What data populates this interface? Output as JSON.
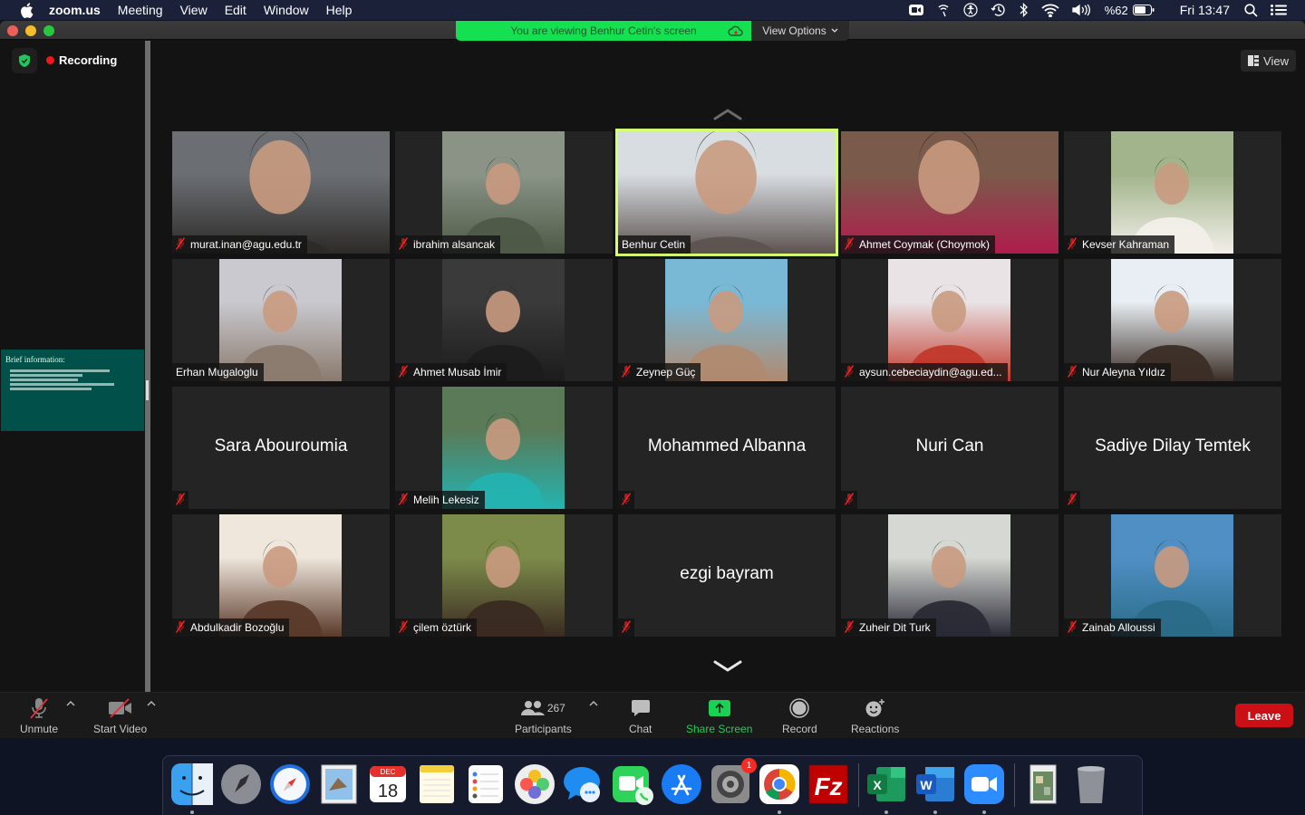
{
  "menubar": {
    "app_name": "zoom.us",
    "menus": [
      "Meeting",
      "View",
      "Edit",
      "Window",
      "Help"
    ],
    "battery_text": "%62",
    "clock": "Fri 13:47",
    "status_icons": [
      "zoom-icon",
      "airdrop-icon",
      "accessibility-icon",
      "time-machine-icon",
      "bluetooth-icon",
      "wifi-icon",
      "volume-icon",
      "battery-icon",
      "spotlight-icon",
      "control-center-icon"
    ]
  },
  "window": {
    "share_banner": "You are viewing Benhur Cetin's screen",
    "view_options_label": "View Options",
    "recording_label": "Recording",
    "view_button_label": "View",
    "shared_slide": {
      "title": "Brief information:",
      "line_count": 5
    }
  },
  "colors": {
    "share_green": "#14e052",
    "active_speaker": "#d4ff6e",
    "leave_red": "#cc0f14",
    "slide_teal": "#015049"
  },
  "participants": [
    {
      "name": "murat.inan@agu.edu.tr",
      "muted": true,
      "video": "full",
      "tone": [
        "#6b6f74",
        "#2d2a27"
      ]
    },
    {
      "name": "ibrahim alsancak",
      "muted": true,
      "video": "square",
      "tone": [
        "#8a9386",
        "#4e5a47"
      ]
    },
    {
      "name": "Benhur Cetin",
      "muted": false,
      "video": "full",
      "active": true,
      "tone": [
        "#d8dde2",
        "#5d5350"
      ]
    },
    {
      "name": "Ahmet Coymak (Choymok)",
      "muted": true,
      "video": "full",
      "tone": [
        "#7a5a4a",
        "#b01c4d"
      ]
    },
    {
      "name": "Kevser Kahraman",
      "muted": true,
      "video": "square",
      "tone": [
        "#a2b48c",
        "#f2efe9"
      ]
    },
    {
      "name": "Erhan Mugaloglu",
      "muted": false,
      "video": "square",
      "tone": [
        "#c9c9cf",
        "#8b7a6e"
      ]
    },
    {
      "name": "Ahmet Musab İmir",
      "muted": true,
      "video": "square",
      "tone": [
        "#3a3a3a",
        "#1c1c1c"
      ]
    },
    {
      "name": "Zeynep Güç",
      "muted": true,
      "video": "square",
      "tone": [
        "#79b9d6",
        "#b08a70"
      ]
    },
    {
      "name": "aysun.cebeciaydin@agu.ed...",
      "muted": true,
      "video": "square",
      "tone": [
        "#e9e3e6",
        "#c0392b"
      ]
    },
    {
      "name": "Nur Aleyna Yıldız",
      "muted": true,
      "video": "square",
      "tone": [
        "#e8eef3",
        "#3a2d26"
      ]
    },
    {
      "name": "Sara Abouroumia",
      "muted": true,
      "video": "none"
    },
    {
      "name": "Melih Lekesiz",
      "muted": true,
      "video": "square",
      "tone": [
        "#5a7a58",
        "#24b3b0"
      ]
    },
    {
      "name": "Mohammed Albanna",
      "muted": true,
      "video": "none"
    },
    {
      "name": "Nuri Can",
      "muted": true,
      "video": "none"
    },
    {
      "name": "Sadiye Dilay Temtek",
      "muted": true,
      "video": "none"
    },
    {
      "name": "Abdulkadir Bozoğlu",
      "muted": true,
      "video": "square",
      "tone": [
        "#efe6dc",
        "#5a3a2a"
      ]
    },
    {
      "name": "çilem öztürk",
      "muted": true,
      "video": "square",
      "tone": [
        "#7d8b4a",
        "#3a2a22"
      ]
    },
    {
      "name": "ezgi bayram",
      "muted": true,
      "video": "none"
    },
    {
      "name": "Zuheir Dit Turk",
      "muted": true,
      "video": "square",
      "tone": [
        "#d6d8d4",
        "#2a2a36"
      ]
    },
    {
      "name": "Zainab Alloussi",
      "muted": true,
      "video": "square",
      "tone": [
        "#4f8fc4",
        "#2a6c88"
      ]
    }
  ],
  "toolbar": {
    "unmute": "Unmute",
    "start_video": "Start Video",
    "participants": "Participants",
    "participant_count": "267",
    "chat": "Chat",
    "share_screen": "Share Screen",
    "record": "Record",
    "reactions": "Reactions",
    "leave": "Leave"
  },
  "dock": {
    "apps": [
      {
        "name": "Finder",
        "icon": "finder-icon",
        "running": true
      },
      {
        "name": "Launchpad",
        "icon": "launchpad-icon",
        "running": false
      },
      {
        "name": "Safari",
        "icon": "safari-icon",
        "running": false
      },
      {
        "name": "Mail",
        "icon": "mail-icon",
        "running": false
      },
      {
        "name": "Calendar",
        "icon": "calendar-icon",
        "running": false,
        "month": "DEC",
        "day": "18"
      },
      {
        "name": "Notes",
        "icon": "notes-icon",
        "running": false
      },
      {
        "name": "Reminders",
        "icon": "reminders-icon",
        "running": false
      },
      {
        "name": "Photos",
        "icon": "photos-icon",
        "running": false
      },
      {
        "name": "Messages",
        "icon": "messages-icon",
        "running": false
      },
      {
        "name": "FaceTime",
        "icon": "facetime-icon",
        "running": false
      },
      {
        "name": "App Store",
        "icon": "app-store-icon",
        "running": false
      },
      {
        "name": "System Preferences",
        "icon": "system-preferences-icon",
        "running": false,
        "badge": "1"
      },
      {
        "name": "Chrome",
        "icon": "chrome-icon",
        "running": true
      },
      {
        "name": "FileZilla",
        "icon": "filezilla-icon",
        "running": false
      },
      {
        "name": "Excel",
        "icon": "excel-icon",
        "running": true
      },
      {
        "name": "Word",
        "icon": "word-icon",
        "running": true
      },
      {
        "name": "Zoom",
        "icon": "zoom-app-icon",
        "running": true
      },
      {
        "name": "Document",
        "icon": "document-stack-icon",
        "running": false
      },
      {
        "name": "Trash",
        "icon": "trash-icon",
        "running": false
      }
    ]
  }
}
